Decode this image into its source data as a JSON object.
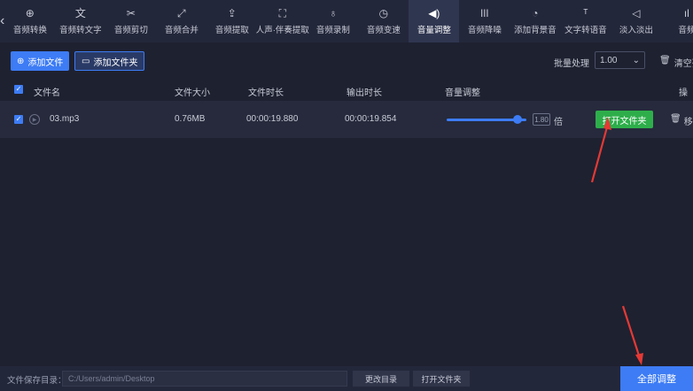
{
  "toolbar": {
    "tools": [
      {
        "label": "音频转换",
        "icon": "audio-convert-icon",
        "glyph": "⊕"
      },
      {
        "label": "音频转文字",
        "icon": "speech-to-text-icon",
        "glyph": "文"
      },
      {
        "label": "音频剪切",
        "icon": "scissors-icon",
        "glyph": "✂"
      },
      {
        "label": "音频合并",
        "icon": "merge-icon",
        "glyph": "⤢"
      },
      {
        "label": "音频提取",
        "icon": "extract-icon",
        "glyph": "⇪"
      },
      {
        "label": "人声·伴奏提取",
        "icon": "vocal-extract-icon",
        "glyph": "⛶"
      },
      {
        "label": "音频录制",
        "icon": "microphone-icon",
        "glyph": "♁"
      },
      {
        "label": "音频变速",
        "icon": "speed-icon",
        "glyph": "◷"
      },
      {
        "label": "音量调整",
        "icon": "volume-icon",
        "glyph": "◀)"
      },
      {
        "label": "音频降噪",
        "icon": "denoise-icon",
        "glyph": "ǀǀǀ"
      },
      {
        "label": "添加背景音",
        "icon": "add-bgm-icon",
        "glyph": "◔"
      },
      {
        "label": "文字转语音",
        "icon": "text-to-speech-icon",
        "glyph": "ᵀ"
      },
      {
        "label": "淡入淡出",
        "icon": "fade-icon",
        "glyph": "◁"
      },
      {
        "label": "音频",
        "icon": "audio-icon",
        "glyph": "ıl"
      }
    ]
  },
  "actions": {
    "add_file": "添加文件",
    "add_folder": "添加文件夹",
    "batch_label": "批量处理",
    "batch_value": "1.00",
    "clear_list": "清空列"
  },
  "table": {
    "headers": {
      "name": "文件名",
      "size": "文件大小",
      "duration": "文件时长",
      "output_duration": "输出时长",
      "volume": "音量调整",
      "ops": "操作"
    },
    "rows": [
      {
        "name": "03.mp3",
        "size": "0.76MB",
        "duration": "00:00:19.880",
        "output_duration": "00:00:19.854",
        "volume_value": "1.80",
        "volume_unit": "倍",
        "open_folder": "打开文件夹",
        "remove": "移动"
      }
    ]
  },
  "bottom": {
    "path_label": "文件保存目录：",
    "path_value": "C:/Users/admin/Desktop",
    "change_dir": "更改目录",
    "open_folder": "打开文件夹",
    "all_adjust": "全部调整"
  },
  "colors": {
    "accent": "#3d7cf5",
    "success": "#2eae4b",
    "annotation": "#e53935"
  }
}
